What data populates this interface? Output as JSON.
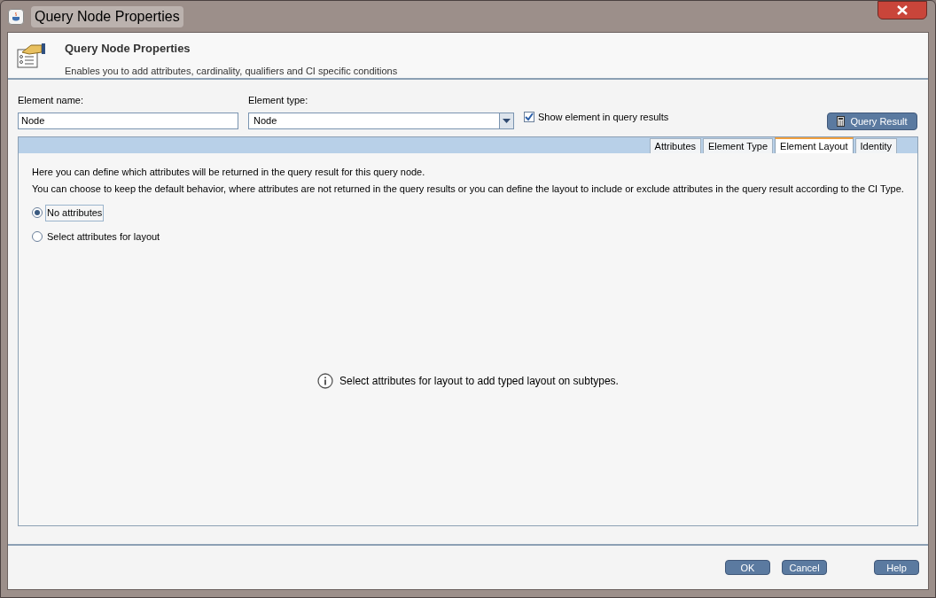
{
  "window": {
    "title": "Query Node Properties"
  },
  "header": {
    "title": "Query Node Properties",
    "subtitle": "Enables you to add attributes, cardinality, qualifiers and CI specific conditions"
  },
  "form": {
    "element_name": {
      "label": "Element name:",
      "value": "Node"
    },
    "element_type": {
      "label": "Element type:",
      "value": "Node"
    },
    "show_in_results": {
      "label": "Show element in query results",
      "checked": true
    },
    "query_result_button": "Query Result"
  },
  "tabs": [
    {
      "label": "Attributes",
      "selected": false
    },
    {
      "label": "Element Type",
      "selected": false
    },
    {
      "label": "Element Layout",
      "selected": true
    },
    {
      "label": "Identity",
      "selected": false
    }
  ],
  "panel": {
    "intro": [
      "Here you can define which attributes will be returned in the query result for this query node.",
      "You can choose to keep the default behavior, where attributes are not returned in the query results or you can define the layout to include or exclude attributes in the query result according to the CI Type."
    ],
    "options": [
      {
        "label": "No attributes",
        "selected": true
      },
      {
        "label": "Select attributes for layout",
        "selected": false
      }
    ],
    "info": "Select attributes for layout to add typed layout on subtypes."
  },
  "buttons": [
    "OK",
    "Cancel",
    "Help"
  ]
}
